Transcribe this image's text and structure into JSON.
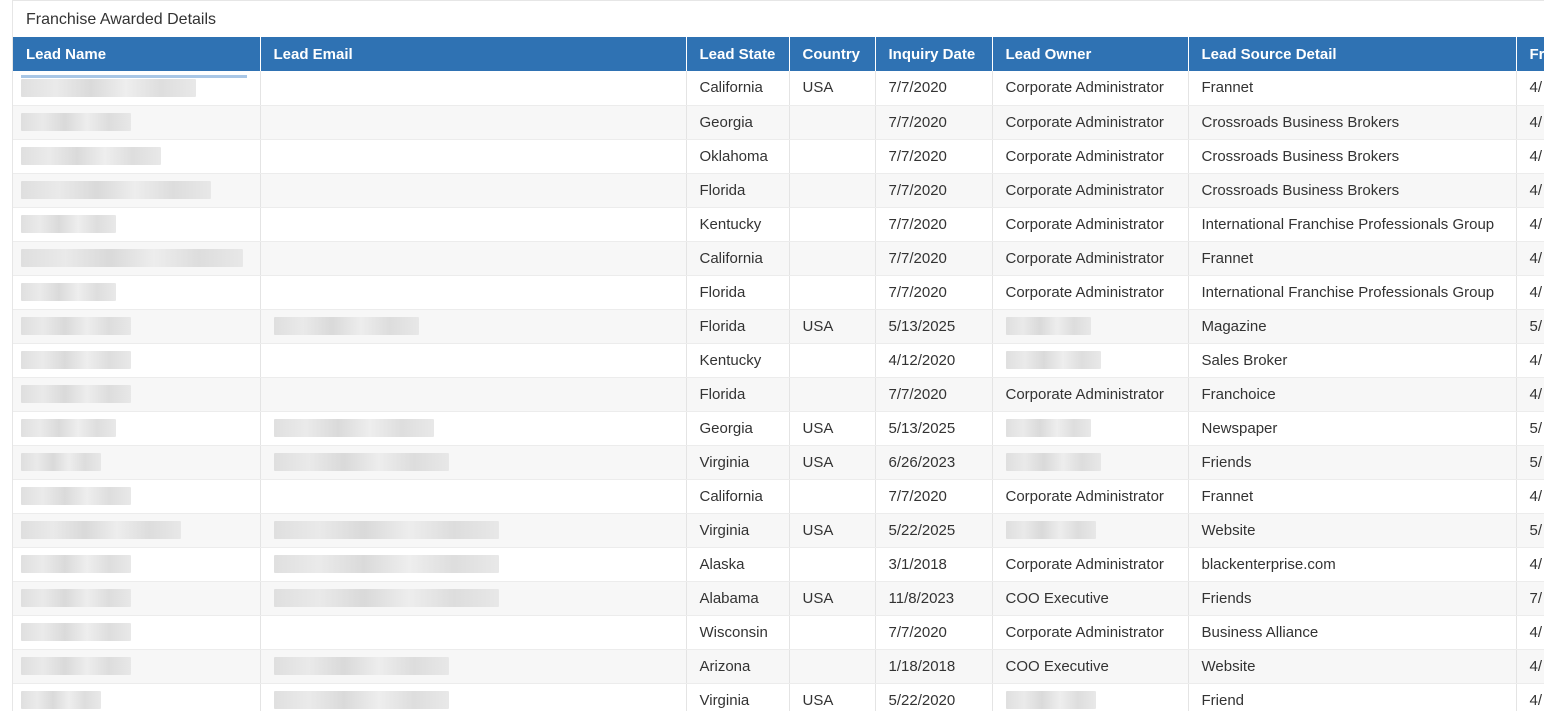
{
  "panel": {
    "title": "Franchise Awarded Details"
  },
  "columns": [
    "Lead Name",
    "Lead Email",
    "Lead State",
    "Country",
    "Inquiry Date",
    "Lead Owner",
    "Lead Source Detail",
    "Fr"
  ],
  "rows": [
    {
      "state": "California",
      "country": "USA",
      "date": "7/7/2020",
      "owner": "Corporate Administrator",
      "source": "Frannet",
      "next": "4/"
    },
    {
      "state": "Georgia",
      "country": "",
      "date": "7/7/2020",
      "owner": "Corporate Administrator",
      "source": "Crossroads Business Brokers",
      "next": "4/"
    },
    {
      "state": "Oklahoma",
      "country": "",
      "date": "7/7/2020",
      "owner": "Corporate Administrator",
      "source": "Crossroads Business Brokers",
      "next": "4/"
    },
    {
      "state": "Florida",
      "country": "",
      "date": "7/7/2020",
      "owner": "Corporate Administrator",
      "source": "Crossroads Business Brokers",
      "next": "4/"
    },
    {
      "state": "Kentucky",
      "country": "",
      "date": "7/7/2020",
      "owner": "Corporate Administrator",
      "source": "International Franchise Professionals Group",
      "next": "4/"
    },
    {
      "state": "California",
      "country": "",
      "date": "7/7/2020",
      "owner": "Corporate Administrator",
      "source": "Frannet",
      "next": "4/"
    },
    {
      "state": "Florida",
      "country": "",
      "date": "7/7/2020",
      "owner": "Corporate Administrator",
      "source": "International Franchise Professionals Group",
      "next": "4/"
    },
    {
      "state": "Florida",
      "country": "USA",
      "date": "5/13/2025",
      "owner": "",
      "source": "Magazine",
      "next": "5/"
    },
    {
      "state": "Kentucky",
      "country": "",
      "date": "4/12/2020",
      "owner": "",
      "source": "Sales Broker",
      "next": "4/"
    },
    {
      "state": "Florida",
      "country": "",
      "date": "7/7/2020",
      "owner": "Corporate Administrator",
      "source": "Franchoice",
      "next": "4/"
    },
    {
      "state": "Georgia",
      "country": "USA",
      "date": "5/13/2025",
      "owner": "",
      "source": "Newspaper",
      "next": "5/"
    },
    {
      "state": "Virginia",
      "country": "USA",
      "date": "6/26/2023",
      "owner": "",
      "source": "Friends",
      "next": "5/"
    },
    {
      "state": "California",
      "country": "",
      "date": "7/7/2020",
      "owner": "Corporate Administrator",
      "source": "Frannet",
      "next": "4/"
    },
    {
      "state": "Virginia",
      "country": "USA",
      "date": "5/22/2025",
      "owner": "",
      "source": "Website",
      "next": "5/"
    },
    {
      "state": "Alaska",
      "country": "",
      "date": "3/1/2018",
      "owner": "Corporate Administrator",
      "source": "blackenterprise.com",
      "next": "4/"
    },
    {
      "state": "Alabama",
      "country": "USA",
      "date": "11/8/2023",
      "owner": "COO Executive",
      "source": "Friends",
      "next": "7/"
    },
    {
      "state": "Wisconsin",
      "country": "",
      "date": "7/7/2020",
      "owner": "Corporate Administrator",
      "source": "Business Alliance",
      "next": "4/"
    },
    {
      "state": "Arizona",
      "country": "",
      "date": "1/18/2018",
      "owner": "COO Executive",
      "source": "Website",
      "next": "4/"
    },
    {
      "state": "Virginia",
      "country": "USA",
      "date": "5/22/2020",
      "owner": "",
      "source": "Friend",
      "next": "4/"
    }
  ]
}
